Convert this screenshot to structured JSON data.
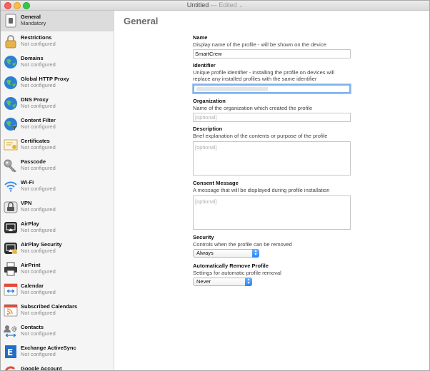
{
  "window": {
    "title": "Untitled",
    "edited": "— Edited",
    "caret": "⌄"
  },
  "sidebar": {
    "items": [
      {
        "title": "General",
        "subtitle": "Mandatory",
        "icon": "general-icon"
      },
      {
        "title": "Restrictions",
        "subtitle": "Not configured",
        "icon": "lock-icon"
      },
      {
        "title": "Domains",
        "subtitle": "Not configured",
        "icon": "globe-icon"
      },
      {
        "title": "Global HTTP Proxy",
        "subtitle": "Not configured",
        "icon": "globe-icon"
      },
      {
        "title": "DNS Proxy",
        "subtitle": "Not configured",
        "icon": "globe-icon"
      },
      {
        "title": "Content Filter",
        "subtitle": "Not configured",
        "icon": "globe-icon"
      },
      {
        "title": "Certificates",
        "subtitle": "Not configured",
        "icon": "certificate-icon"
      },
      {
        "title": "Passcode",
        "subtitle": "Not configured",
        "icon": "key-icon"
      },
      {
        "title": "Wi-Fi",
        "subtitle": "Not configured",
        "icon": "wifi-icon"
      },
      {
        "title": "VPN",
        "subtitle": "Not configured",
        "icon": "vpn-icon"
      },
      {
        "title": "AirPlay",
        "subtitle": "Not configured",
        "icon": "airplay-icon"
      },
      {
        "title": "AirPlay Security",
        "subtitle": "Not configured",
        "icon": "airplay-security-icon"
      },
      {
        "title": "AirPrint",
        "subtitle": "Not configured",
        "icon": "printer-icon"
      },
      {
        "title": "Calendar",
        "subtitle": "Not configured",
        "icon": "calendar-icon"
      },
      {
        "title": "Subscribed Calendars",
        "subtitle": "Not configured",
        "icon": "rss-icon"
      },
      {
        "title": "Contacts",
        "subtitle": "Not configured",
        "icon": "contacts-icon"
      },
      {
        "title": "Exchange ActiveSync",
        "subtitle": "Not configured",
        "icon": "exchange-icon"
      },
      {
        "title": "Google Account",
        "subtitle": "",
        "icon": "google-icon"
      }
    ]
  },
  "main": {
    "title": "General",
    "name": {
      "label": "Name",
      "desc": "Display name of the profile - will be shown on the device",
      "value": "SmartCrew"
    },
    "identifier": {
      "label": "Identifier",
      "desc1": "Unique profile identifier - installing the profile on devices will",
      "desc2": "replace any installed profiles with the same identifier",
      "value": ""
    },
    "organization": {
      "label": "Organization",
      "desc": "Name of the organization which created the profile",
      "placeholder": "[optional]"
    },
    "description": {
      "label": "Description",
      "desc": "Brief explanation of the contents or purpose of the profile",
      "placeholder": "[optional]"
    },
    "consent": {
      "label": "Consent Message",
      "desc": "A message that will be displayed during profile installation",
      "placeholder": "[optional]"
    },
    "security": {
      "label": "Security",
      "desc": "Controls when the profile can be removed",
      "value": "Always"
    },
    "auto_remove": {
      "label": "Automatically Remove Profile",
      "desc": "Settings for automatic profile removal",
      "value": "Never"
    }
  },
  "colors": {
    "accent": "#2b83f6",
    "focus_ring": "#7fb2ea",
    "sidebar_bg": "#f5f5f5",
    "selected_bg": "#dcdcdc"
  }
}
